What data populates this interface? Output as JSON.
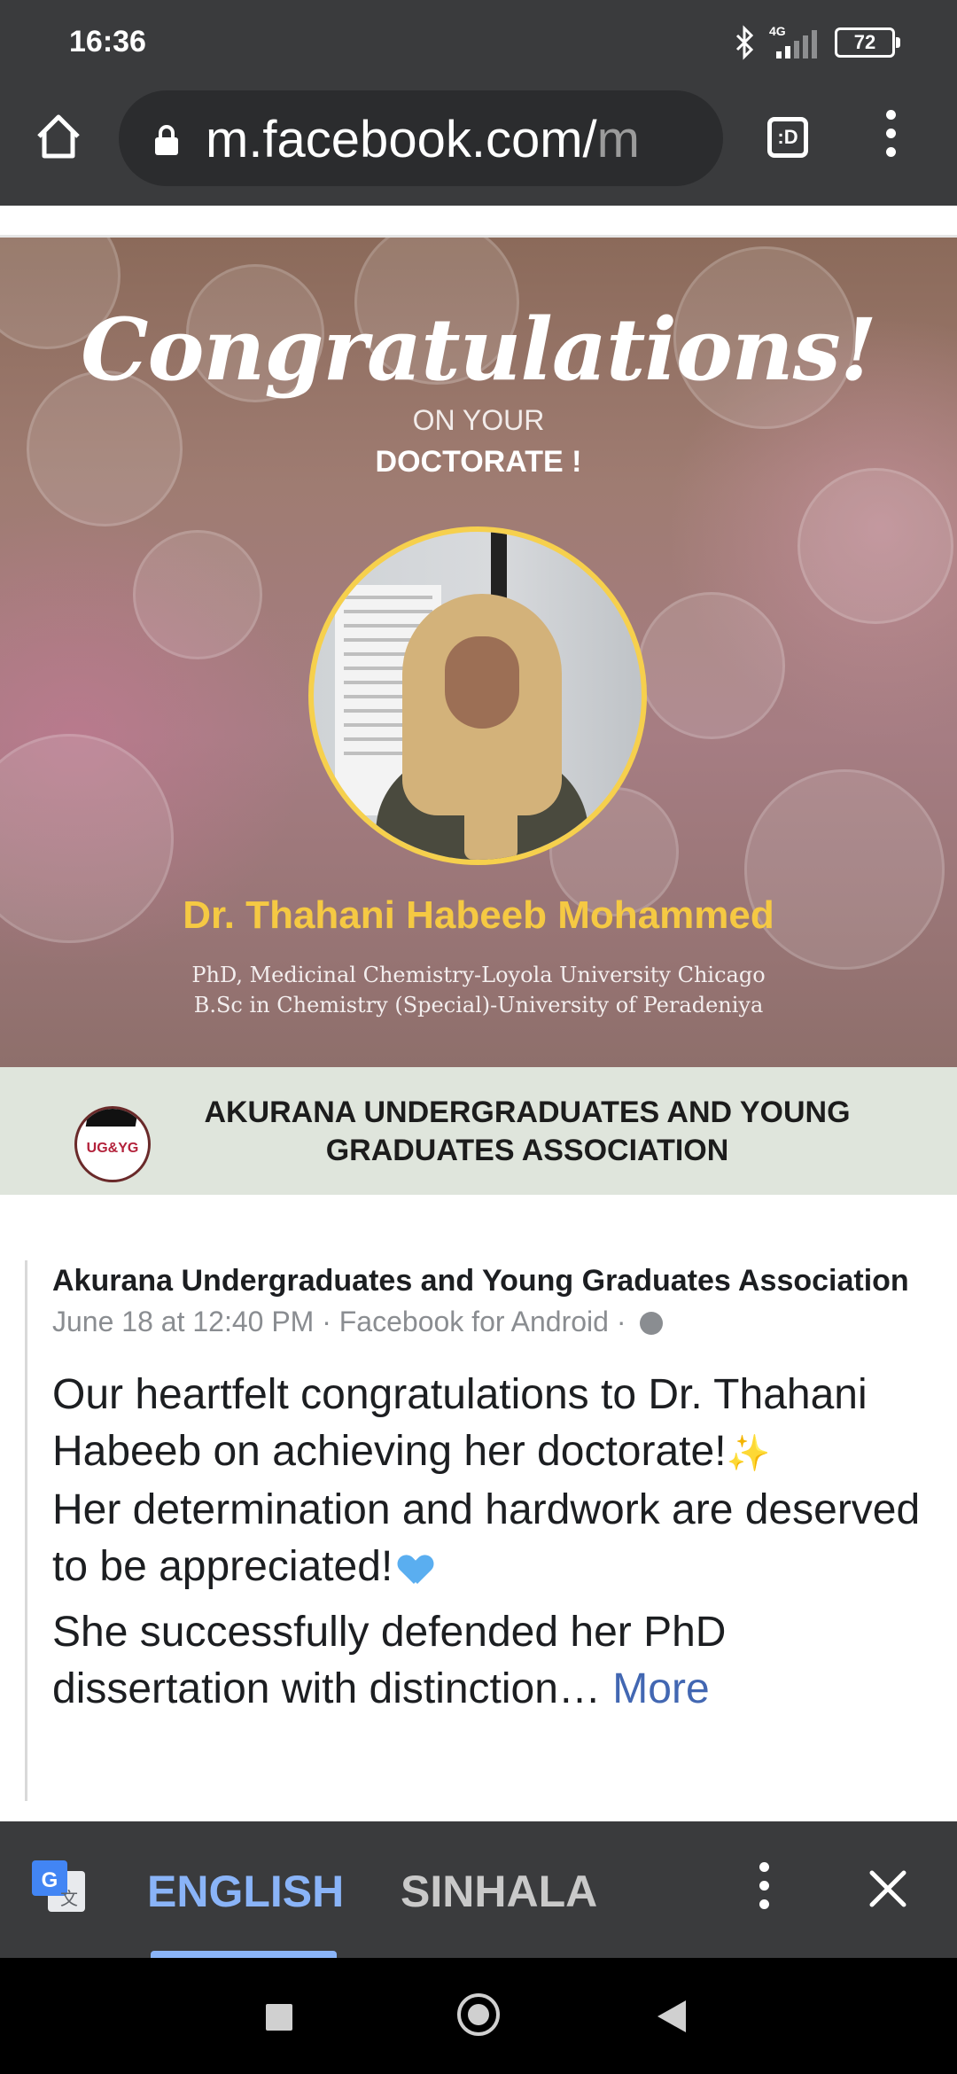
{
  "status_bar": {
    "time": "16:36",
    "network": "4G",
    "battery": "72"
  },
  "browser": {
    "url_main": "m.facebook.com/",
    "url_fade": "m",
    "tabs_label": ":D"
  },
  "banner": {
    "heading": "Congratulations!",
    "line1": "ON YOUR",
    "line2": "DOCTORATE !",
    "name": "Dr. Thahani Habeeb Mohammed",
    "degree1": "PhD, Medicinal Chemistry-Loyola University Chicago",
    "degree2": "B.Sc in Chemistry (Special)-University of Peradeniya",
    "logo_text": "UG&YG",
    "logo_small": "AKURANA",
    "association": "AKURANA UNDERGRADUATES AND YOUNG GRADUATES ASSOCIATION"
  },
  "post": {
    "page_name": "Akurana Undergraduates and Young Graduates Association",
    "meta": "June 18 at 12:40 PM · Facebook for Android ·",
    "para1_a": "Our heartfelt congratulations to Dr. Thahani Habeeb on achieving her doctorate!",
    "para1_b": "Her determination and hardwork are deserved to be appreciated!",
    "para2": "She successfully defended her PhD dissertation with distinction…",
    "more": "More",
    "sparkle": "✨"
  },
  "translate_bar": {
    "lang_active": "ENGLISH",
    "lang_other": "SINHALA"
  },
  "colors": {
    "chrome": "#3a3b3d",
    "accent_blue": "#8ab4f8",
    "name_gold": "#f5c943",
    "link_blue": "#4267b2"
  }
}
